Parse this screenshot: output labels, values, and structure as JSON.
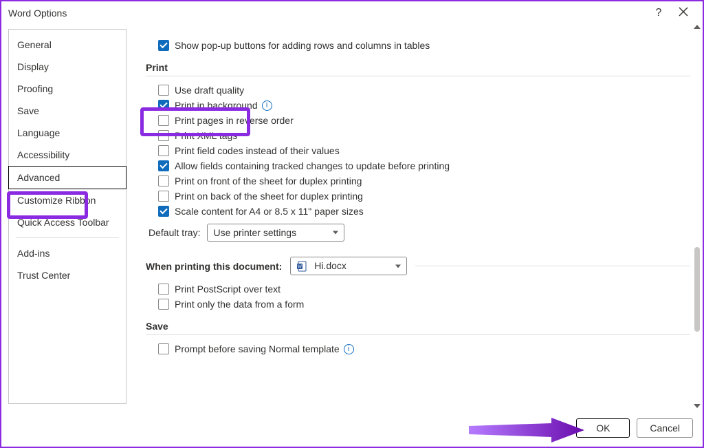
{
  "window": {
    "title": "Word Options",
    "help": "?",
    "close": "✕"
  },
  "sidebar": {
    "items": [
      {
        "label": "General"
      },
      {
        "label": "Display"
      },
      {
        "label": "Proofing"
      },
      {
        "label": "Save"
      },
      {
        "label": "Language"
      },
      {
        "label": "Accessibility"
      },
      {
        "label": "Advanced",
        "selected": true
      },
      {
        "label": "Customize Ribbon"
      },
      {
        "label": "Quick Access Toolbar"
      }
    ],
    "items2": [
      {
        "label": "Add-ins"
      },
      {
        "label": "Trust Center"
      }
    ]
  },
  "top_option": {
    "label": "Show pop-up buttons for adding rows and columns in tables",
    "checked": true
  },
  "sections": {
    "print": {
      "title": "Print",
      "options": [
        {
          "label": "Use draft quality",
          "checked": false
        },
        {
          "label": "Print in background",
          "checked": true,
          "info": true
        },
        {
          "label": "Print pages in reverse order",
          "checked": false
        },
        {
          "label": "Print XML tags",
          "checked": false
        },
        {
          "label": "Print field codes instead of their values",
          "checked": false
        },
        {
          "label": "Allow fields containing tracked changes to update before printing",
          "checked": true
        },
        {
          "label": "Print on front of the sheet for duplex printing",
          "checked": false
        },
        {
          "label": "Print on back of the sheet for duplex printing",
          "checked": false
        },
        {
          "label": "Scale content for A4 or 8.5 x 11\" paper sizes",
          "checked": true
        }
      ],
      "tray_label": "Default tray:",
      "tray_value": "Use printer settings"
    },
    "doc": {
      "title": "When printing this document:",
      "file": "Hi.docx",
      "options": [
        {
          "label": "Print PostScript over text",
          "checked": false
        },
        {
          "label": "Print only the data from a form",
          "checked": false
        }
      ]
    },
    "save": {
      "title": "Save",
      "options": [
        {
          "label": "Prompt before saving Normal template",
          "checked": false,
          "info": true
        }
      ]
    }
  },
  "footer": {
    "ok": "OK",
    "cancel": "Cancel"
  }
}
